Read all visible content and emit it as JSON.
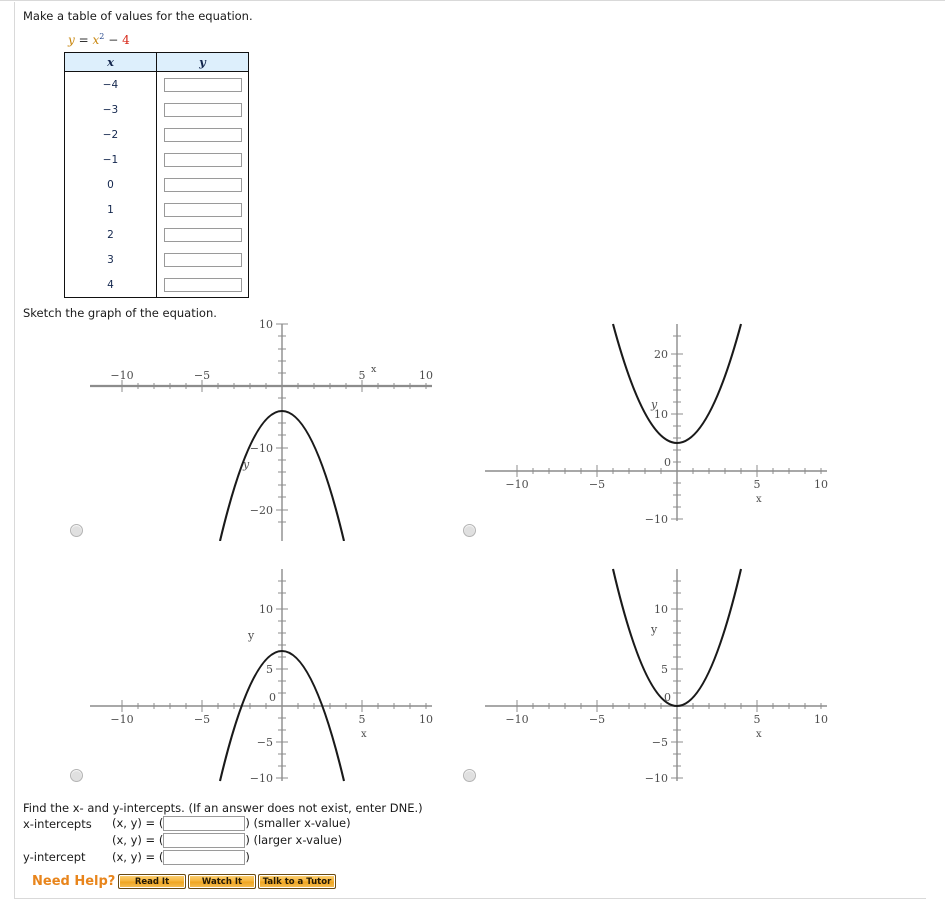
{
  "prompts": {
    "make_table": "Make a table of values for the equation.",
    "sketch_graph": "Sketch the graph of the equation.",
    "find_intercepts": "Find the x- and y-intercepts. (If an answer does not exist, enter DNE.)"
  },
  "equation": {
    "lhs": "y",
    "equals": "=",
    "base": "x",
    "exponent": "2",
    "minus": "−",
    "constant": "4",
    "full": "y = x2 − 4"
  },
  "values_table": {
    "headers": [
      "x",
      "y"
    ],
    "x_values": [
      "−4",
      "−3",
      "−2",
      "−1",
      "0",
      "1",
      "2",
      "3",
      "4"
    ],
    "y_values": [
      "",
      "",
      "",
      "",
      "",
      "",
      "",
      "",
      ""
    ],
    "header_bg": "#ddeffc",
    "border_color": "#111111"
  },
  "graph_options": [
    {
      "id": "option-a",
      "selected": false,
      "chart_data": {
        "type": "line",
        "title": "",
        "xlabel": "x",
        "ylabel": "y",
        "equation": "y = -x^2 - 4",
        "xlim": [
          -11,
          11
        ],
        "ylim": [
          -25,
          11
        ],
        "xticks": [
          -10,
          -5,
          5,
          10
        ],
        "xtick_labels": [
          "−10",
          "−5",
          "5",
          "10"
        ],
        "yticks": [
          10,
          -10,
          -20
        ],
        "ytick_labels": [
          "10",
          "−10",
          "−20"
        ],
        "grid": false,
        "vertex": [
          0,
          -4
        ],
        "opens": "down"
      }
    },
    {
      "id": "option-b",
      "selected": false,
      "chart_data": {
        "type": "line",
        "title": "",
        "xlabel": "x",
        "ylabel": "y",
        "equation": "y = x^2 + 4",
        "xlim": [
          -11,
          11
        ],
        "ylim": [
          -11,
          26
        ],
        "xticks": [
          -10,
          -5,
          0,
          5,
          10
        ],
        "xtick_labels": [
          "−10",
          "−5",
          "0",
          "5",
          "10"
        ],
        "yticks": [
          20,
          10,
          -10
        ],
        "ytick_labels": [
          "20",
          "10",
          "−10"
        ],
        "grid": false,
        "vertex": [
          0,
          4
        ],
        "opens": "up"
      }
    },
    {
      "id": "option-c",
      "selected": false,
      "chart_data": {
        "type": "line",
        "title": "",
        "xlabel": "x",
        "ylabel": "y",
        "equation": "y = -x^2 + 4",
        "xlim": [
          -11,
          11
        ],
        "ylim": [
          -11,
          13
        ],
        "xticks": [
          -10,
          -5,
          0,
          5,
          10
        ],
        "xtick_labels": [
          "−10",
          "−5",
          "0",
          "5",
          "10"
        ],
        "yticks": [
          10,
          5,
          -5,
          -10
        ],
        "ytick_labels": [
          "10",
          "5",
          "−5",
          "−10"
        ],
        "grid": false,
        "vertex": [
          0,
          4
        ],
        "opens": "down"
      }
    },
    {
      "id": "option-d",
      "selected": false,
      "chart_data": {
        "type": "line",
        "title": "",
        "xlabel": "x",
        "ylabel": "y",
        "equation": "y = x^2 - 4",
        "xlim": [
          -11,
          11
        ],
        "ylim": [
          -11,
          13
        ],
        "xticks": [
          -10,
          -5,
          0,
          5,
          10
        ],
        "xtick_labels": [
          "−10",
          "−5",
          "0",
          "5",
          "10"
        ],
        "yticks": [
          10,
          5,
          -5,
          -10
        ],
        "ytick_labels": [
          "10",
          "5",
          "−5",
          "−10"
        ],
        "grid": false,
        "vertex": [
          0,
          -4
        ],
        "opens": "up"
      }
    }
  ],
  "intercepts": {
    "x_label": "x-intercepts",
    "y_label": "y-intercept",
    "pair_prefix": "(x, y) = (",
    "pair_suffix": ")",
    "rows": [
      {
        "note": "(smaller x-value)",
        "value": ""
      },
      {
        "note": "(larger x-value)",
        "value": ""
      },
      {
        "note": "",
        "value": ""
      }
    ]
  },
  "need_help": {
    "label": "Need Help?",
    "buttons": [
      {
        "id": "read-it",
        "label": "Read It"
      },
      {
        "id": "watch-it",
        "label": "Watch It"
      },
      {
        "id": "talk-tutor",
        "label": "Talk to a Tutor"
      }
    ],
    "accent_color": "#e8851c"
  }
}
